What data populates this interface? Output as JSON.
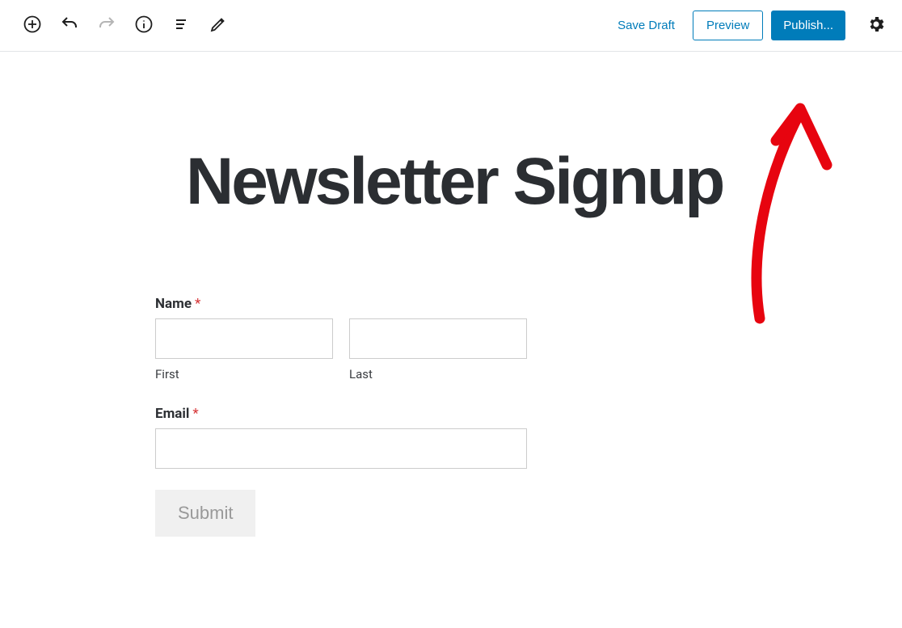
{
  "toolbar": {
    "save_draft": "Save Draft",
    "preview": "Preview",
    "publish": "Publish..."
  },
  "page": {
    "title": "Newsletter Signup"
  },
  "form": {
    "name_label": "Name",
    "required_mark": "*",
    "first_sub": "First",
    "last_sub": "Last",
    "email_label": "Email",
    "submit_label": "Submit"
  },
  "icons": {
    "add": "add-icon",
    "undo": "undo-icon",
    "redo": "redo-icon",
    "info": "info-icon",
    "outline": "outline-icon",
    "edit": "edit-icon",
    "settings": "gear-icon",
    "add_footer": "add-block-icon"
  },
  "colors": {
    "accent": "#007cba",
    "required": "#d63638",
    "annotation": "#e7040f"
  }
}
